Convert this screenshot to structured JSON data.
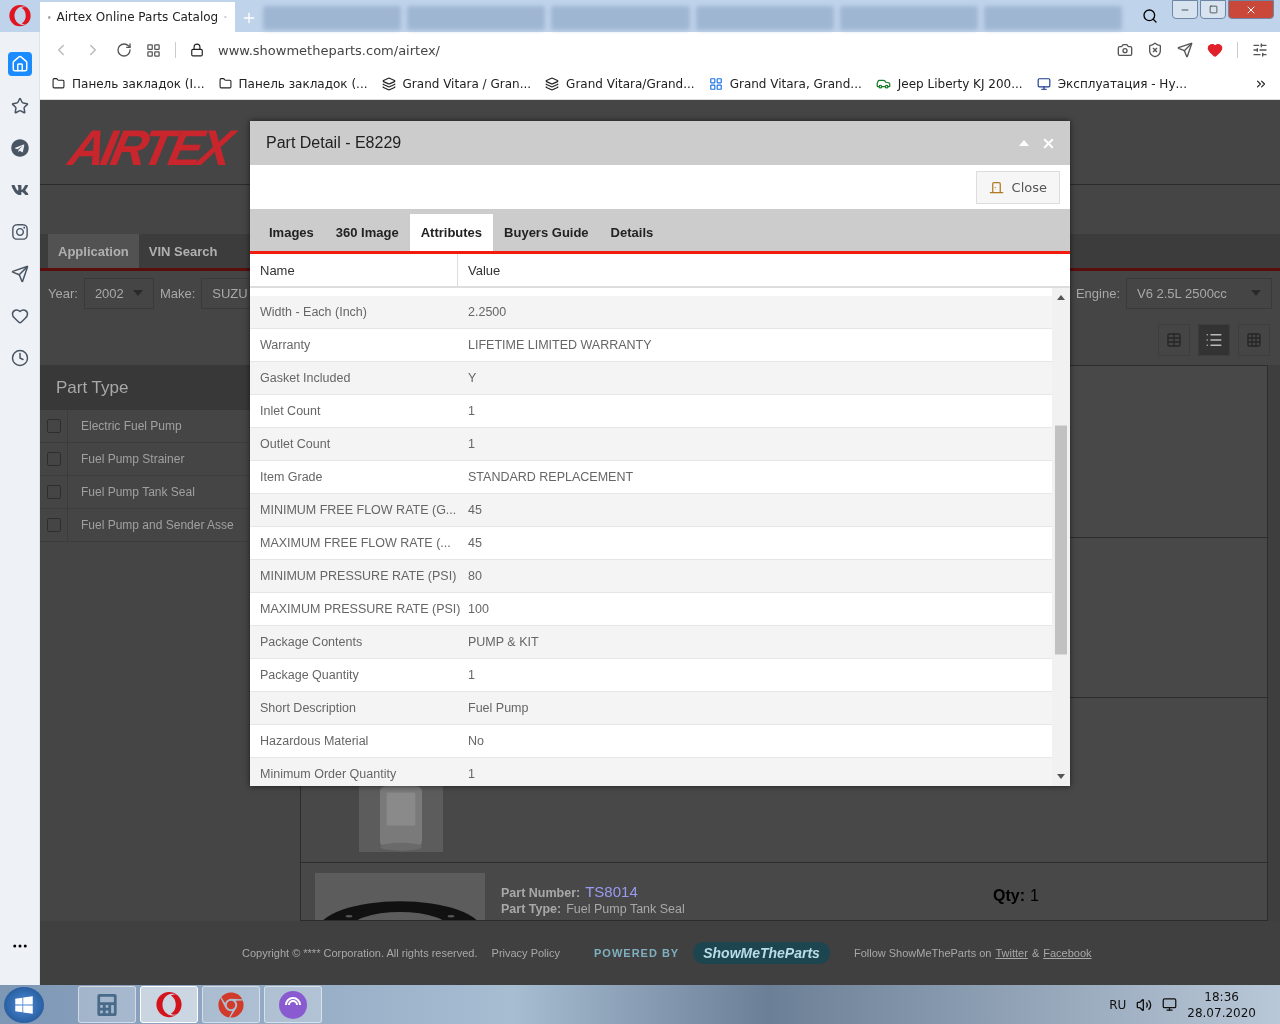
{
  "browser": {
    "tabs": [
      {
        "title": "Airtex Online Parts Catalog",
        "selected": true
      }
    ],
    "url": "www.showmetheparts.com/airtex/",
    "bookmarks": [
      {
        "kind": "folder",
        "label": "Панель закладок (I..."
      },
      {
        "kind": "folder",
        "label": "Панель закладок (..."
      },
      {
        "kind": "stripes",
        "label": "Grand Vitara / Gran..."
      },
      {
        "kind": "stripes",
        "label": "Grand Vitara/Grand..."
      },
      {
        "kind": "tile",
        "label": "Grand Vitara, Grand..."
      },
      {
        "kind": "car",
        "label": "Jeep Liberty KJ 200..."
      },
      {
        "kind": "club",
        "label": "Эксплуатация - Ну..."
      }
    ]
  },
  "sidebar": [
    {
      "kind": "home",
      "selected": true
    },
    {
      "kind": "star",
      "selected": false
    },
    {
      "kind": "telegram",
      "selected": false
    },
    {
      "kind": "vk",
      "selected": false
    },
    {
      "kind": "instagram",
      "selected": false
    },
    {
      "kind": "send",
      "selected": false
    },
    {
      "kind": "heart",
      "selected": false
    },
    {
      "kind": "clock",
      "selected": false
    }
  ],
  "page": {
    "logo": "AIRTEX",
    "tabs": [
      {
        "label": "Application",
        "selected": true
      },
      {
        "label": "VIN Search",
        "selected": false
      }
    ],
    "filters": [
      {
        "label": "Year:",
        "value": "2002"
      },
      {
        "label": "Make:",
        "value": "SUZU"
      }
    ],
    "engine": {
      "label": "Engine:",
      "value": "V6 2.5L 2500cc"
    },
    "views": [
      {
        "kind": "table",
        "selected": false
      },
      {
        "kind": "list",
        "selected": true
      },
      {
        "kind": "grid",
        "selected": false
      }
    ],
    "part_type": {
      "title": "Part Type",
      "items": [
        {
          "label": "Electric Fuel Pump",
          "checked": false
        },
        {
          "label": "Fuel Pump Strainer",
          "checked": false
        },
        {
          "label": "Fuel Pump Tank Seal",
          "checked": false
        },
        {
          "label": "Fuel Pump and Sender Asse",
          "checked": false
        }
      ]
    },
    "result": {
      "part_number_label": "Part Number:",
      "part_number": "TS8014",
      "part_type_label": "Part Type:",
      "part_type": "Fuel Pump Tank Seal",
      "qty_label": "Qty:",
      "qty": "1"
    },
    "footer": {
      "copyright": "Copyright © **** Corporation. All rights reserved.",
      "privacy": "Privacy Policy",
      "powered_by": "POWERED BY",
      "brand": "ShowMeTheParts",
      "follow": "Follow ShowMeTheParts on",
      "twitter": "Twitter",
      "amp": "&",
      "facebook": "Facebook"
    }
  },
  "modal": {
    "title": "Part Detail - E8229",
    "close_label": "Close",
    "tabs": [
      {
        "label": "Images",
        "selected": false
      },
      {
        "label": "360 Image",
        "selected": false
      },
      {
        "label": "Attributes",
        "selected": true
      },
      {
        "label": "Buyers Guide",
        "selected": false
      },
      {
        "label": "Details",
        "selected": false
      }
    ],
    "columns": [
      "Name",
      "Value"
    ],
    "rows": [
      {
        "name": "Width - Each (Inch)",
        "value": "2.2500"
      },
      {
        "name": "Warranty",
        "value": "LIFETIME LIMITED WARRANTY"
      },
      {
        "name": "Gasket Included",
        "value": "Y"
      },
      {
        "name": "Inlet Count",
        "value": "1"
      },
      {
        "name": "Outlet Count",
        "value": "1"
      },
      {
        "name": "Item Grade",
        "value": "STANDARD REPLACEMENT"
      },
      {
        "name": "MINIMUM FREE FLOW RATE (G...",
        "value": "45"
      },
      {
        "name": "MAXIMUM FREE FLOW RATE (...",
        "value": "45"
      },
      {
        "name": "MINIMUM PRESSURE RATE (PSI)",
        "value": "80"
      },
      {
        "name": "MAXIMUM PRESSURE RATE (PSI)",
        "value": "100"
      },
      {
        "name": "Package Contents",
        "value": "PUMP & KIT"
      },
      {
        "name": "Package Quantity",
        "value": "1"
      },
      {
        "name": "Short Description",
        "value": "Fuel Pump"
      },
      {
        "name": "Hazardous Material",
        "value": "No"
      },
      {
        "name": "Minimum Order Quantity",
        "value": "1"
      }
    ]
  },
  "taskbar": {
    "apps": [
      {
        "kind": "calculator",
        "selected": false
      },
      {
        "kind": "opera",
        "selected": true
      },
      {
        "kind": "chrome",
        "selected": false
      },
      {
        "kind": "torrent",
        "selected": false
      }
    ],
    "language": "RU",
    "time": "18:36",
    "date": "28.07.2020"
  }
}
